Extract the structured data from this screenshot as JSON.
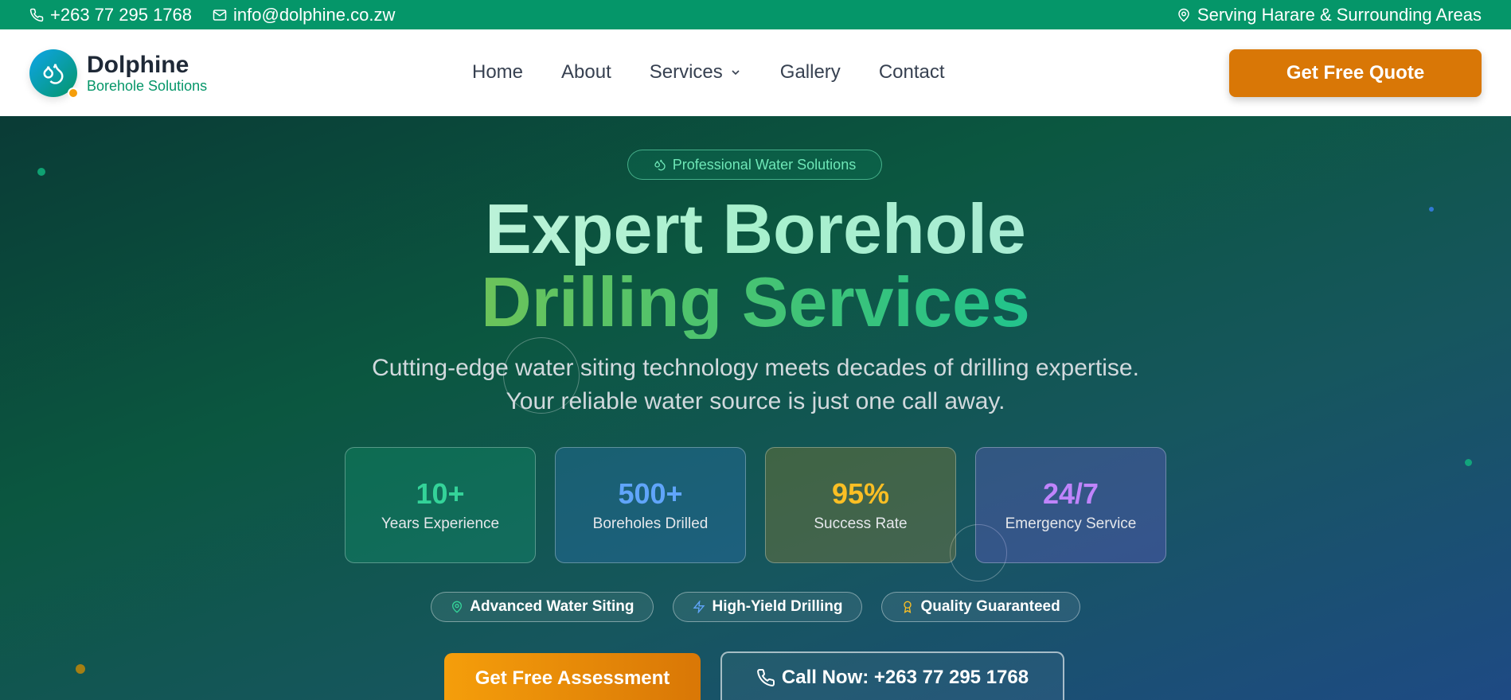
{
  "topbar": {
    "phone": "+263 77 295 1768",
    "email": "info@dolphine.co.zw",
    "location": "Serving Harare & Surrounding Areas"
  },
  "header": {
    "brand_name": "Dolphine",
    "brand_sub": "Borehole Solutions",
    "nav": [
      {
        "label": "Home"
      },
      {
        "label": "About"
      },
      {
        "label": "Services",
        "has_dropdown": true
      },
      {
        "label": "Gallery"
      },
      {
        "label": "Contact"
      }
    ],
    "quote_label": "Get Free Quote"
  },
  "hero": {
    "badge": "Professional Water Solutions",
    "title_line1": "Expert Borehole",
    "title_line2": "Drilling Services",
    "subtitle": "Cutting-edge water siting technology meets decades of drilling expertise. Your reliable water source is just one call away.",
    "stats": [
      {
        "value": "10+",
        "label": "Years Experience",
        "color": "#34d399"
      },
      {
        "value": "500+",
        "label": "Boreholes Drilled",
        "color": "#60a5fa"
      },
      {
        "value": "95%",
        "label": "Success Rate",
        "color": "#fbbf24"
      },
      {
        "value": "24/7",
        "label": "Emergency Service",
        "color": "#c084fc"
      }
    ],
    "features": [
      {
        "label": "Advanced Water Siting",
        "icon": "map-pin-icon"
      },
      {
        "label": "High-Yield Drilling",
        "icon": "lightning-icon"
      },
      {
        "label": "Quality Guaranteed",
        "icon": "award-icon"
      }
    ],
    "cta_primary": "Get Free Assessment",
    "cta_secondary": "Call Now: +263 77 295 1768"
  },
  "colors": {
    "brand_green": "#059669",
    "accent_orange": "#d97706"
  }
}
